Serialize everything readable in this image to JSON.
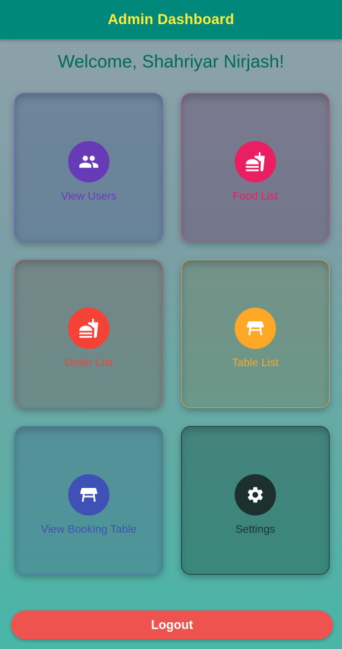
{
  "appbar": {
    "title": "Admin Dashboard"
  },
  "welcome": "Welcome, Shahriyar Nirjash!",
  "cards": [
    {
      "label": "View Users",
      "icon": "people-icon",
      "color": "#673ab7"
    },
    {
      "label": "Food List",
      "icon": "fastfood-icon",
      "color": "#e91e63"
    },
    {
      "label": "Order List",
      "icon": "fastfood-icon",
      "color": "#f44336"
    },
    {
      "label": "Table List",
      "icon": "table-icon",
      "color": "#ffa726"
    },
    {
      "label": "View Booking Table",
      "icon": "table-icon",
      "color": "#3f51b5"
    },
    {
      "label": "Settings",
      "icon": "gear-icon",
      "color": "#1c302e"
    }
  ],
  "logout_label": "Logout",
  "colors": {
    "appbar": "#00897b",
    "title": "#ffeb3b",
    "welcome": "#00695c",
    "logout": "#ef5350"
  }
}
